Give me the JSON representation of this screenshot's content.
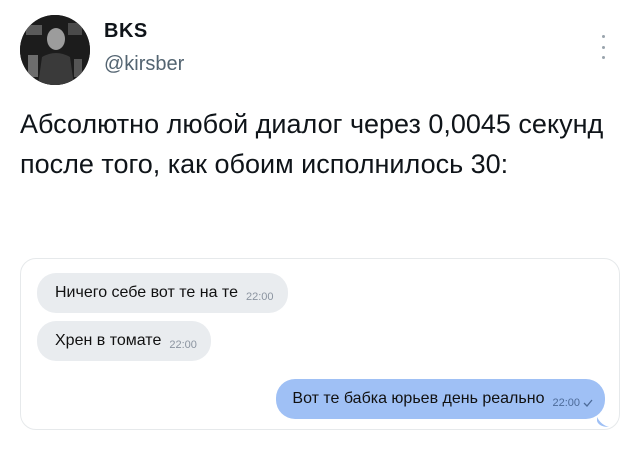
{
  "tweet": {
    "author_name": "BKS",
    "author_handle": "@kirsber",
    "text": "Абсолютно любой диалог через 0,0045 секунд после того, как обоим исполнилось 30:"
  },
  "chat": {
    "messages": [
      {
        "direction": "incoming",
        "text": "Ничего себе вот те на те",
        "time": "22:00"
      },
      {
        "direction": "incoming",
        "text": "Хрен в томате",
        "time": "22:00"
      },
      {
        "direction": "outgoing",
        "text": "Вот те бабка юрьев день реально",
        "time": "22:00",
        "status": "read"
      }
    ]
  },
  "colors": {
    "incoming_bubble": "#e9ecef",
    "outgoing_bubble": "#9fc0f5",
    "handle": "#536471"
  },
  "icons": {
    "more": "vertical-dots-icon",
    "read_status": "check-icon"
  }
}
